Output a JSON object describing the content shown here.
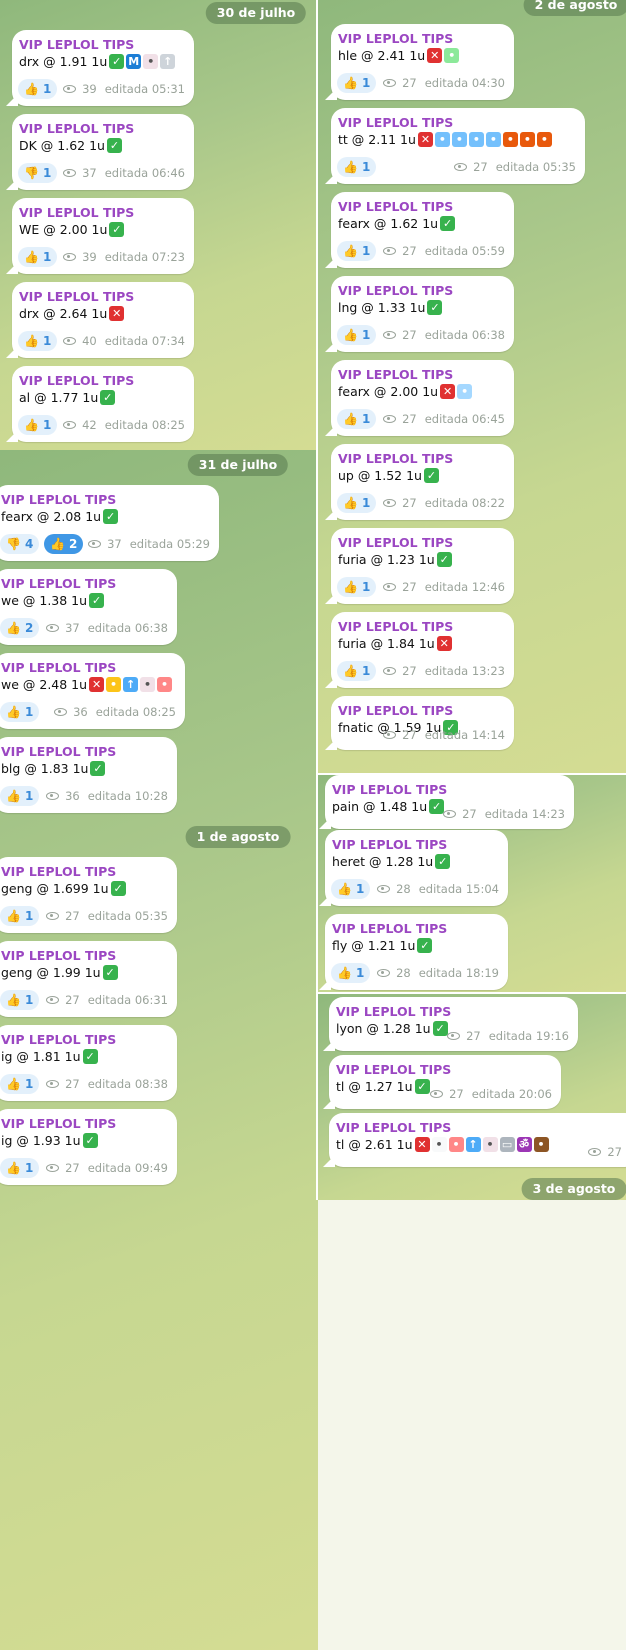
{
  "channel": "VIP LEPLOL TIPS",
  "emoji_legend": {
    "win": "green-check",
    "loss": "red-cross",
    "thumbs_up": "👍",
    "thumbs_down": "👎"
  },
  "left_column": {
    "date_1": "30 de julho",
    "date_2": "31 de julho",
    "date_3": "1 de agosto",
    "messages": [
      {
        "author": "VIP LEPLOL TIPS",
        "text": "drx @ 1.91 1u",
        "emojis": [
          "check",
          "metro",
          "mouse",
          "rocket"
        ],
        "reactions": [
          {
            "emoji": "👍",
            "count": "1"
          }
        ],
        "views": "39",
        "edited": "editada 05:31"
      },
      {
        "author": "VIP LEPLOL TIPS",
        "text": "DK @ 1.62 1u",
        "emojis": [
          "check"
        ],
        "reactions": [
          {
            "emoji": "👎",
            "count": "1"
          }
        ],
        "views": "37",
        "edited": "editada 06:46"
      },
      {
        "author": "VIP LEPLOL TIPS",
        "text": "WE @ 2.00 1u",
        "emojis": [
          "check"
        ],
        "reactions": [
          {
            "emoji": "👍",
            "count": "1"
          }
        ],
        "views": "39",
        "edited": "editada 07:23"
      },
      {
        "author": "VIP LEPLOL TIPS",
        "text": "drx @ 2.64 1u",
        "emojis": [
          "cross"
        ],
        "reactions": [
          {
            "emoji": "👍",
            "count": "1"
          }
        ],
        "views": "40",
        "edited": "editada 07:34"
      },
      {
        "author": "VIP LEPLOL TIPS",
        "text": "al @ 1.77 1u",
        "emojis": [
          "check"
        ],
        "reactions": [
          {
            "emoji": "👍",
            "count": "1"
          }
        ],
        "views": "42",
        "edited": "editada 08:25"
      },
      {
        "author": "VIP LEPLOL TIPS",
        "text": "fearx @ 2.08 1u",
        "emojis": [
          "check"
        ],
        "reactions": [
          {
            "emoji": "👎",
            "count": "4"
          },
          {
            "emoji": "👍",
            "count": "2"
          }
        ],
        "views": "37",
        "edited": "editada 05:29"
      },
      {
        "author": "VIP LEPLOL TIPS",
        "text": "we @ 1.38 1u",
        "emojis": [
          "check"
        ],
        "reactions": [
          {
            "emoji": "👍",
            "count": "2"
          }
        ],
        "views": "37",
        "edited": "editada 06:38"
      },
      {
        "author": "VIP LEPLOL TIPS",
        "text": "we @ 2.48 1u",
        "emojis": [
          "cross",
          "worried",
          "mouse-up",
          "mouse",
          "clown"
        ],
        "reactions": [
          {
            "emoji": "👍",
            "count": "1"
          }
        ],
        "views": "36",
        "edited": "editada 08:25"
      },
      {
        "author": "VIP LEPLOL TIPS",
        "text": "blg @ 1.83 1u",
        "emojis": [
          "check"
        ],
        "reactions": [
          {
            "emoji": "👍",
            "count": "1"
          }
        ],
        "views": "36",
        "edited": "editada 10:28"
      },
      {
        "author": "VIP LEPLOL TIPS",
        "text": "geng @ 1.699 1u",
        "emojis": [
          "check"
        ],
        "reactions": [
          {
            "emoji": "👍",
            "count": "1"
          }
        ],
        "views": "27",
        "edited": "editada 05:35"
      },
      {
        "author": "VIP LEPLOL TIPS",
        "text": "geng @ 1.99 1u",
        "emojis": [
          "check"
        ],
        "reactions": [
          {
            "emoji": "👍",
            "count": "1"
          }
        ],
        "views": "27",
        "edited": "editada 06:31"
      },
      {
        "author": "VIP LEPLOL TIPS",
        "text": "ig @ 1.81 1u",
        "emojis": [
          "check"
        ],
        "reactions": [
          {
            "emoji": "👍",
            "count": "1"
          }
        ],
        "views": "27",
        "edited": "editada 08:38"
      },
      {
        "author": "VIP LEPLOL TIPS",
        "text": "ig @ 1.93 1u",
        "emojis": [
          "check"
        ],
        "reactions": [
          {
            "emoji": "👍",
            "count": "1"
          }
        ],
        "views": "27",
        "edited": "editada 09:49"
      }
    ]
  },
  "right_column": {
    "date_top": "2 de agosto",
    "date_bottom": "3 de agosto",
    "messages": [
      {
        "author": "VIP LEPLOL TIPS",
        "text": "hle @ 2.41 1u",
        "emojis": [
          "cross",
          "sick"
        ],
        "reactions": [
          {
            "emoji": "👍",
            "count": "1"
          }
        ],
        "views": "27",
        "edited": "editada 04:30"
      },
      {
        "author": "VIP LEPLOL TIPS",
        "text": "tt @ 2.11 1u",
        "emojis": [
          "cross",
          "scream",
          "scream",
          "scream",
          "scream",
          "cursing",
          "cursing",
          "cursing"
        ],
        "reactions": [
          {
            "emoji": "👍",
            "count": "1"
          }
        ],
        "views": "27",
        "edited": "editada 05:35"
      },
      {
        "author": "VIP LEPLOL TIPS",
        "text": "fearx @ 1.62 1u",
        "emojis": [
          "check"
        ],
        "reactions": [
          {
            "emoji": "👍",
            "count": "1"
          }
        ],
        "views": "27",
        "edited": "editada 05:59"
      },
      {
        "author": "VIP LEPLOL TIPS",
        "text": "lng @ 1.33 1u",
        "emojis": [
          "check"
        ],
        "reactions": [
          {
            "emoji": "👍",
            "count": "1"
          }
        ],
        "views": "27",
        "edited": "editada 06:38"
      },
      {
        "author": "VIP LEPLOL TIPS",
        "text": "fearx @ 2.00 1u",
        "emojis": [
          "cross",
          "cold"
        ],
        "reactions": [
          {
            "emoji": "👍",
            "count": "1"
          }
        ],
        "views": "27",
        "edited": "editada 06:45"
      },
      {
        "author": "VIP LEPLOL TIPS",
        "text": "up @ 1.52 1u",
        "emojis": [
          "check"
        ],
        "reactions": [
          {
            "emoji": "👍",
            "count": "1"
          }
        ],
        "views": "27",
        "edited": "editada 08:22"
      },
      {
        "author": "VIP LEPLOL TIPS",
        "text": "furia @ 1.23 1u",
        "emojis": [
          "check"
        ],
        "reactions": [
          {
            "emoji": "👍",
            "count": "1"
          }
        ],
        "views": "27",
        "edited": "editada 12:46"
      },
      {
        "author": "VIP LEPLOL TIPS",
        "text": "furia @ 1.84 1u",
        "emojis": [
          "cross"
        ],
        "reactions": [
          {
            "emoji": "👍",
            "count": "1"
          }
        ],
        "views": "27",
        "edited": "editada 13:23"
      },
      {
        "author": "VIP LEPLOL TIPS",
        "text": "fnatic @ 1.59 1u",
        "emojis": [
          "check"
        ],
        "reactions": [],
        "views": "27",
        "edited": "editada 14:14"
      },
      {
        "author": "VIP LEPLOL TIPS",
        "text": "pain @ 1.48 1u",
        "emojis": [
          "check"
        ],
        "reactions": [],
        "views": "27",
        "edited": "editada 14:23"
      },
      {
        "author": "VIP LEPLOL TIPS",
        "text": "heret @ 1.28 1u",
        "emojis": [
          "check"
        ],
        "reactions": [
          {
            "emoji": "👍",
            "count": "1"
          }
        ],
        "views": "28",
        "edited": "editada 15:04"
      },
      {
        "author": "VIP LEPLOL TIPS",
        "text": "fly @ 1.21 1u",
        "emojis": [
          "check"
        ],
        "reactions": [
          {
            "emoji": "👍",
            "count": "1"
          }
        ],
        "views": "28",
        "edited": "editada 18:19"
      },
      {
        "author": "VIP LEPLOL TIPS",
        "text": "lyon @ 1.28 1u",
        "emojis": [
          "check"
        ],
        "reactions": [],
        "views": "27",
        "edited": "editada 19:16"
      },
      {
        "author": "VIP LEPLOL TIPS",
        "text": "tl @ 1.27 1u",
        "emojis": [
          "check"
        ],
        "reactions": [],
        "views": "27",
        "edited": "editada 20:06"
      },
      {
        "author": "VIP LEPLOL TIPS",
        "text": "tl @ 2.61 1u",
        "emojis": [
          "cross",
          "eyes",
          "clown",
          "mouse-up",
          "mouse",
          "trash",
          "om",
          "poop"
        ],
        "reactions": [],
        "views": "27",
        "edited": ""
      }
    ]
  }
}
